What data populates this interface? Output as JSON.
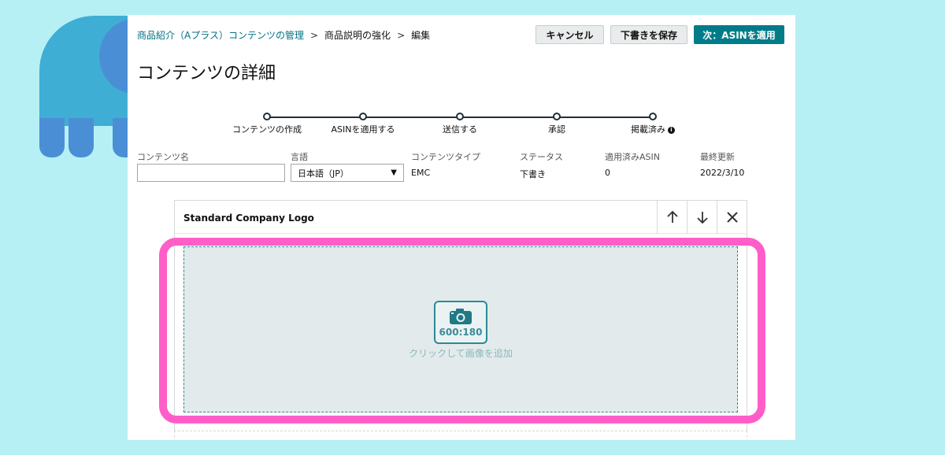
{
  "breadcrumb": {
    "items": [
      "商品紹介（Aプラス）コンテンツの管理",
      "商品説明の強化",
      "編集"
    ],
    "separator": ">"
  },
  "header": {
    "cancel_label": "キャンセル",
    "save_draft_label": "下書きを保存",
    "next_label": "次：ASINを適用"
  },
  "page": {
    "title": "コンテンツの詳細"
  },
  "stepper": {
    "steps": [
      "コンテンツの作成",
      "ASINを適用する",
      "送信する",
      "承認",
      "掲載済み"
    ],
    "info_glyph": "i"
  },
  "meta": {
    "content_name_label": "コンテンツ名",
    "content_name_value": "",
    "language_label": "言語",
    "language_value": "日本語（JP）",
    "content_type_label": "コンテンツタイプ",
    "content_type_value": "EMC",
    "status_label": "ステータス",
    "status_value": "下書き",
    "applied_asin_label": "適用済みASIN",
    "applied_asin_value": "0",
    "last_updated_label": "最終更新",
    "last_updated_value": "2022/3/10"
  },
  "module": {
    "title": "Standard Company Logo",
    "image_ratio": "600:180",
    "add_image_text": "クリックして画像を追加",
    "actions": [
      "move-up-icon",
      "move-down-icon",
      "close-icon"
    ]
  },
  "colors": {
    "background": "#b6f0f4",
    "primary": "#007c88",
    "highlight": "#ff5ec8",
    "dropzone": "#e3eaeb"
  }
}
